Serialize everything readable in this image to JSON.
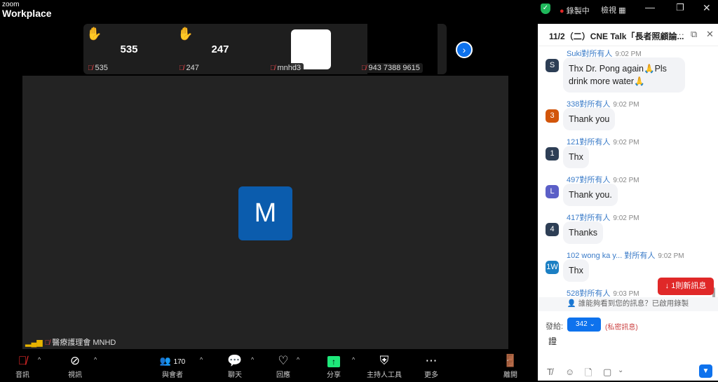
{
  "app": {
    "brand_small": "zoom",
    "brand_large": "Workplace"
  },
  "titlebar": {
    "recording": "錄製中",
    "view": "檢視",
    "accent": "#1fb85b"
  },
  "strip": {
    "tiles": [
      {
        "big": "535",
        "label": "535",
        "hand": true
      },
      {
        "big": "247",
        "label": "247",
        "hand": true
      },
      {
        "big": "",
        "label": "mnhd3",
        "hand": false
      },
      {
        "big": "",
        "label": "943 7388 9615",
        "hand": false
      }
    ]
  },
  "main": {
    "avatar_letter": "M",
    "label": "醫療護理會 MNHD",
    "avatar_color": "#0b5cad"
  },
  "toolbar": {
    "audio": "音訊",
    "video": "視訊",
    "participants": "與會者",
    "participants_count": "170",
    "chat": "聊天",
    "reactions": "回應",
    "share": "分享",
    "host_tools": "主持人工具",
    "more": "更多",
    "leave": "離開"
  },
  "chat": {
    "title": "11/2（二）CNE Talk「長者照顧論...",
    "messages": [
      {
        "sender": "Suki",
        "to": "對所有人",
        "time": "9:02 PM",
        "avatar": "S",
        "color": "#2d3e55",
        "text": "Thx Dr. Pong again🙏Pls drink more water🙏"
      },
      {
        "sender": "338",
        "to": "對所有人",
        "time": "9:02 PM",
        "avatar": "3",
        "color": "#d2550a",
        "text": "Thank you"
      },
      {
        "sender": "121",
        "to": "對所有人",
        "time": "9:02 PM",
        "avatar": "1",
        "color": "#2d3e55",
        "text": "Thx"
      },
      {
        "sender": "497",
        "to": "對所有人",
        "time": "9:02 PM",
        "avatar": "L",
        "color": "#5b5fc7",
        "text": "Thank you."
      },
      {
        "sender": "417",
        "to": "對所有人",
        "time": "9:02 PM",
        "avatar": "4",
        "color": "#2d3e55",
        "text": "Thanks"
      },
      {
        "sender": "102 wong ka y...",
        "to": " 對所有人",
        "time": "9:02 PM",
        "avatar": "1W",
        "color": "#1b7fc3",
        "text": "Thx"
      },
      {
        "sender": "528",
        "to": "對所有人",
        "time": "9:03 PM",
        "avatar": "",
        "color": "#2d3e55",
        "text": ""
      }
    ],
    "new_messages": "↓  1則新訊息",
    "notice": "誰能夠看到您的訊息？已啟用錄製",
    "send_to_label": "發給:",
    "recipient": "342",
    "private_note": "(私密訊息)",
    "input_value": "證"
  }
}
